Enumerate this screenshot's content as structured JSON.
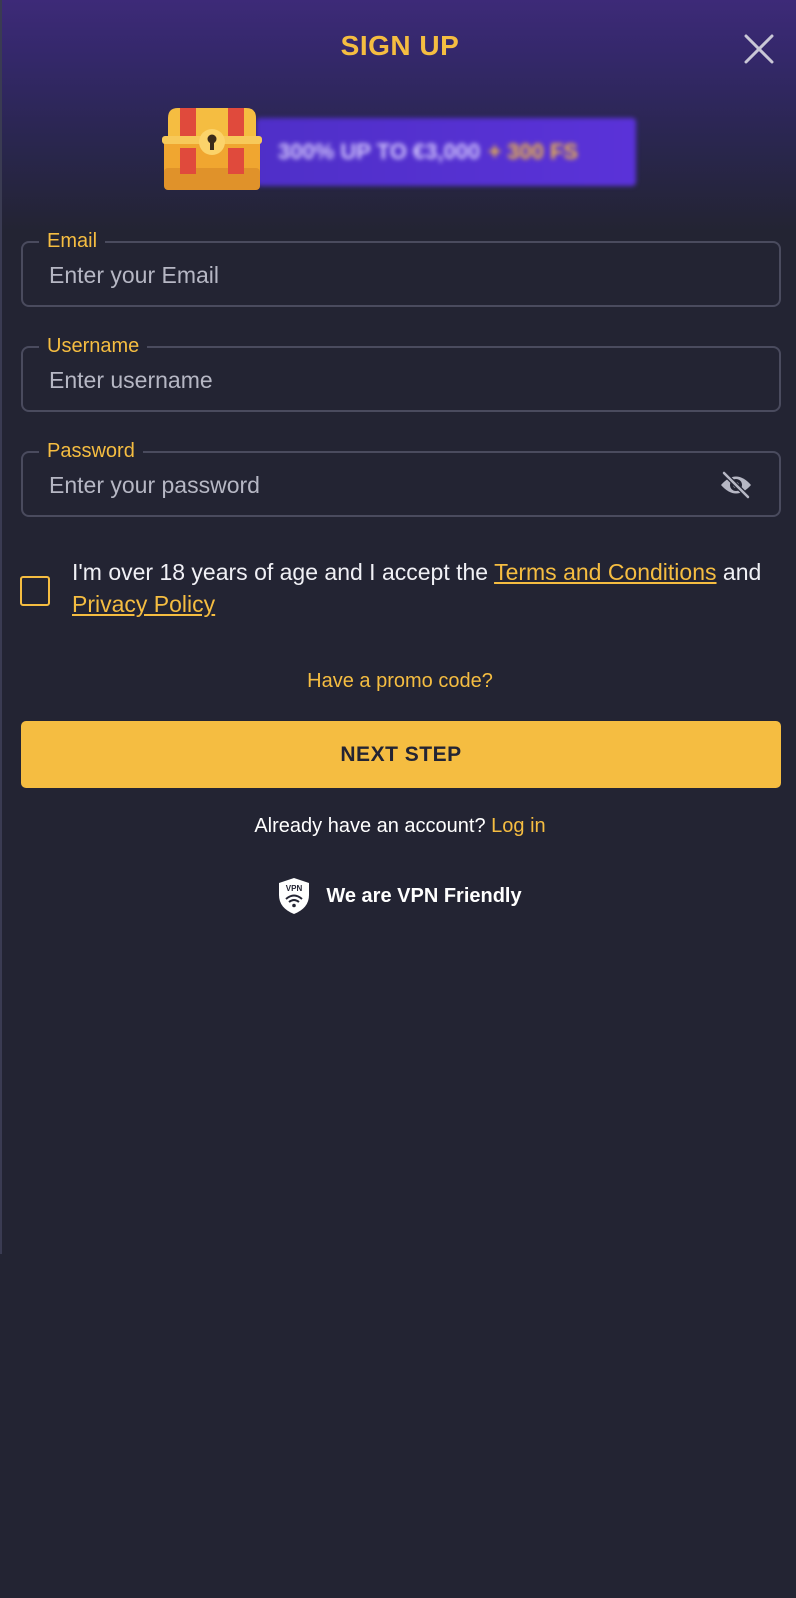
{
  "modal": {
    "title": "SIGN UP",
    "promo_banner": {
      "text": "300% UP TO €3,000",
      "highlight": "+ 300 FS"
    }
  },
  "form": {
    "email": {
      "label": "Email",
      "placeholder": "Enter your Email"
    },
    "username": {
      "label": "Username",
      "placeholder": "Enter username"
    },
    "password": {
      "label": "Password",
      "placeholder": "Enter your password"
    },
    "terms": {
      "prefix": "I'm over 18 years of age and I accept the ",
      "terms_link": "Terms and Conditions",
      "middle": " and ",
      "privacy_link": "Privacy Policy"
    },
    "promo_code_link": "Have a promo code?",
    "next_button": "NEXT STEP",
    "login_prompt": "Already have an account?",
    "login_link": "Log in",
    "vpn_text": "We are VPN Friendly",
    "vpn_badge": "VPN"
  },
  "colors": {
    "accent": "#f5bd41",
    "background": "#232433",
    "header_purple": "#3d2a78",
    "banner_purple": "#5a32d8",
    "field_border": "#4a4b5e"
  },
  "icons": [
    "close-icon",
    "treasure-chest-icon",
    "eye-slash-icon",
    "vpn-shield-icon"
  ]
}
